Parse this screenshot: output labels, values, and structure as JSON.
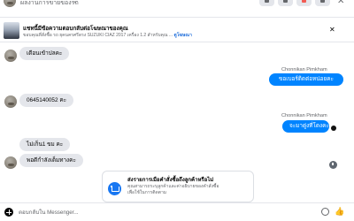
{
  "header": {
    "name": "ผลงานการขายของรถ",
    "chevron": "⌄"
  },
  "ad": {
    "title": "แชทนี้มีข้อความตอบกลับต่อโฆษณาของคุณ",
    "subtitle": "ขอบคุณที่สั่งซื้อ รถ ยุคนครศรีดรง SUZUKI CIAZ 2017 เครื่อง 1.2 สำหรับคุณ ...",
    "link": "ดูโฆษณา",
    "close": "✕"
  },
  "messages": [
    {
      "id": "m1",
      "text": "เดือนเข้าปลคะ"
    },
    {
      "id": "m2",
      "sender": "Chonnikan Pimkham",
      "text": "ขอเบอร์ติดต่อหน่อยคะ"
    },
    {
      "id": "m3",
      "text": "0645140052 คะ"
    },
    {
      "id": "m4",
      "sender": "Chonnikan Pimkham",
      "text": "จะมาดู่งที่โดงคะ"
    },
    {
      "id": "m5",
      "text": "ไม่เก็น1 ขม คะ"
    },
    {
      "id": "m6",
      "text": "พอดีกำลังเต็มทางคะ"
    }
  ],
  "auto_reply": {
    "title": "ส่งรายการเมือคำสั่งซื้อถึงลูกค้าหรือไม่",
    "body_line1": "คุณสามารถระบุลูกค้าและค่าอธิบายของคำสั่งซื้อ",
    "body_line2": "เพื่อใช้ในการติดตาม"
  },
  "composer": {
    "placeholder": "ตอบกลับใน Messenger..."
  }
}
